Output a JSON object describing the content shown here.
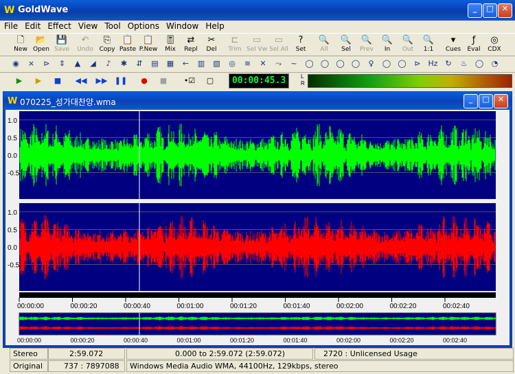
{
  "app": {
    "title": "GoldWave"
  },
  "menu": [
    "File",
    "Edit",
    "Effect",
    "View",
    "Tool",
    "Options",
    "Window",
    "Help"
  ],
  "toolbar": [
    {
      "label": "New",
      "icon": "new-icon",
      "enabled": true
    },
    {
      "label": "Open",
      "icon": "open-icon",
      "enabled": true
    },
    {
      "label": "Save",
      "icon": "save-icon",
      "enabled": false
    },
    {
      "label": "Undo",
      "icon": "undo-icon",
      "enabled": false
    },
    {
      "label": "Copy",
      "icon": "copy-icon",
      "enabled": true
    },
    {
      "label": "Paste",
      "icon": "paste-icon",
      "enabled": true
    },
    {
      "label": "P.New",
      "icon": "paste-new-icon",
      "enabled": true
    },
    {
      "label": "Mix",
      "icon": "mix-icon",
      "enabled": true
    },
    {
      "label": "Repl",
      "icon": "replace-icon",
      "enabled": true
    },
    {
      "label": "Del",
      "icon": "delete-icon",
      "enabled": true
    },
    {
      "label": "Trim",
      "icon": "trim-icon",
      "enabled": false
    },
    {
      "label": "Sel Vw",
      "icon": "select-view-icon",
      "enabled": false
    },
    {
      "label": "Sel All",
      "icon": "select-all-icon",
      "enabled": false
    },
    {
      "label": "Set",
      "icon": "set-icon",
      "enabled": true
    },
    {
      "label": "All",
      "icon": "zoom-all-icon",
      "enabled": false
    },
    {
      "label": "Sel",
      "icon": "zoom-select-icon",
      "enabled": true
    },
    {
      "label": "Prev",
      "icon": "zoom-prev-icon",
      "enabled": false
    },
    {
      "label": "In",
      "icon": "zoom-in-icon",
      "enabled": true
    },
    {
      "label": "Out",
      "icon": "zoom-out-icon",
      "enabled": false
    },
    {
      "label": "1:1",
      "icon": "zoom-1-1-icon",
      "enabled": true
    },
    {
      "label": "Cues",
      "icon": "cues-icon",
      "enabled": true
    },
    {
      "label": "Eval",
      "icon": "eval-icon",
      "enabled": true
    },
    {
      "label": "CDX",
      "icon": "cdx-icon",
      "enabled": true
    }
  ],
  "transport": {
    "time": "00:00:45.3",
    "meter_labels": [
      "L",
      "R"
    ]
  },
  "document": {
    "title": "070225_성가대찬양.wma",
    "left_axis": [
      "1.0",
      "0.5",
      "0.0",
      "-0.5"
    ],
    "right_axis": [
      "1.0",
      "0.5",
      "0.0",
      "-0.5"
    ],
    "timeline": [
      "00:00:00",
      "00:00:20",
      "00:00:40",
      "00:01:00",
      "00:01:20",
      "00:01:40",
      "00:02:00",
      "00:02:20",
      "00:02:40"
    ],
    "colors": {
      "left": "#00ff00",
      "right": "#ff0000",
      "bg": "#000080"
    }
  },
  "status": {
    "channels": "Stereo",
    "length": "2:59.072",
    "selection": "0.000 to 2:59.072 (2:59.072)",
    "usage": "2720 : Unlicensed Usage",
    "mode": "Original",
    "ratio": "737 : 7897088",
    "format": "Windows Media Audio WMA, 44100Hz, 129kbps, stereo"
  }
}
